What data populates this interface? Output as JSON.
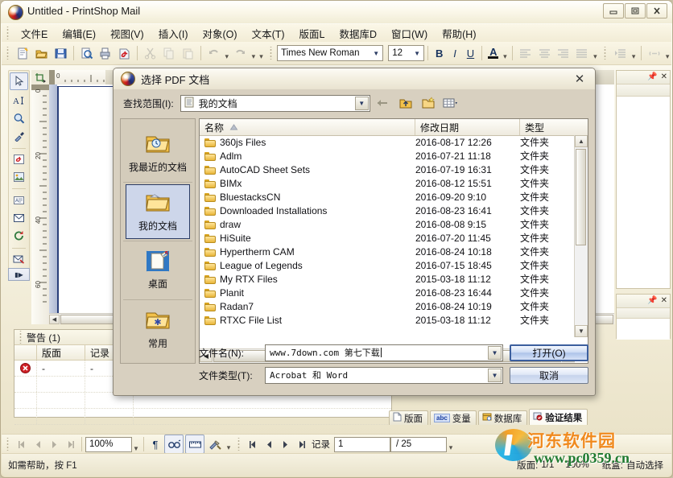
{
  "app": {
    "title": "Untitled - PrintShop Mail",
    "icon": "printshop-logo-icon",
    "window_buttons": [
      {
        "name": "minimize",
        "glyph": "minimize-icon"
      },
      {
        "name": "maximize",
        "glyph": "maximize-icon"
      },
      {
        "name": "close",
        "glyph": "close-icon"
      }
    ]
  },
  "menu": {
    "items": [
      {
        "label": "文件E"
      },
      {
        "label": "编辑(E)"
      },
      {
        "label": "视图(V)"
      },
      {
        "label": "插入(I)"
      },
      {
        "label": "对象(O)"
      },
      {
        "label": "文本(T)"
      },
      {
        "label": "版面L"
      },
      {
        "label": "数据库D"
      },
      {
        "label": "窗口(W)"
      },
      {
        "label": "帮助(H)"
      }
    ]
  },
  "toolbar": {
    "font_name": "Times New Roman",
    "font_size": "12",
    "bold": "B",
    "italic": "I",
    "underline": "U",
    "font_color": "A"
  },
  "document": {
    "ruler_h_origin": "0",
    "ruler_v_ticks": [
      "0",
      "20",
      "40",
      "60"
    ]
  },
  "warnings_panel": {
    "title": "警告 (1)",
    "columns": [
      "版面",
      "记录"
    ],
    "rows": [
      {
        "icon": "error-icon",
        "layout": "-",
        "record": "-"
      }
    ]
  },
  "bottom_tabs": [
    {
      "label": "版面",
      "icon": "page-icon",
      "active": false
    },
    {
      "label": "变量",
      "icon": "abc-icon",
      "active": false
    },
    {
      "label": "数据库",
      "icon": "database-icon",
      "active": false
    },
    {
      "label": "验证结果",
      "icon": "validate-icon",
      "active": true
    }
  ],
  "bottom_bar": {
    "zoom": "100%",
    "record_label": "记录",
    "record_current": "1",
    "record_total": "/ 25",
    "pilcrow": "¶"
  },
  "status_bar": {
    "help_text": "如需帮助，按 F1",
    "layout_label": "版面:",
    "layout_value": "1/1",
    "zoom_value": "100%",
    "tray_label": "纸盒:",
    "tray_value": "自动选择"
  },
  "watermark": {
    "site_cn": "河东软件园",
    "site_url": "www.pc0359.cn"
  },
  "dialog": {
    "title": "选择 PDF 文档",
    "icon": "printshop-logo-icon",
    "close_label": "✕",
    "look_in_label": "查找范围(I):",
    "look_in_value": "我的文档",
    "nav_buttons": [
      {
        "name": "back-button",
        "glyph": "arrow-left-icon"
      },
      {
        "name": "up-one-level-button",
        "glyph": "folder-up-icon"
      },
      {
        "name": "new-folder-button",
        "glyph": "new-folder-icon"
      },
      {
        "name": "views-button",
        "glyph": "view-list-icon"
      }
    ],
    "places": [
      {
        "label": "我最近的文档",
        "icon": "recent-documents-icon",
        "selected": false
      },
      {
        "label": "我的文档",
        "icon": "my-documents-icon",
        "selected": true
      },
      {
        "label": "桌面",
        "icon": "desktop-icon",
        "selected": false
      },
      {
        "label": "常用",
        "icon": "favorites-icon",
        "selected": false
      }
    ],
    "list": {
      "columns": [
        "名称",
        "修改日期",
        "类型"
      ],
      "sort_column": 0,
      "sort_glyph": "sort-ascending-icon",
      "rows": [
        {
          "name": "360js Files",
          "date": "2016-08-17 12:26",
          "type": "文件夹"
        },
        {
          "name": "Adlm",
          "date": "2016-07-21 11:18",
          "type": "文件夹"
        },
        {
          "name": "AutoCAD Sheet Sets",
          "date": "2016-07-19 16:31",
          "type": "文件夹"
        },
        {
          "name": "BIMx",
          "date": "2016-08-12 15:51",
          "type": "文件夹"
        },
        {
          "name": "BluestacksCN",
          "date": "2016-09-20 9:10",
          "type": "文件夹"
        },
        {
          "name": "Downloaded Installations",
          "date": "2016-08-23 16:41",
          "type": "文件夹"
        },
        {
          "name": "draw",
          "date": "2016-08-08 9:15",
          "type": "文件夹"
        },
        {
          "name": "HiSuite",
          "date": "2016-07-20 11:45",
          "type": "文件夹"
        },
        {
          "name": "Hypertherm CAM",
          "date": "2016-08-24 10:18",
          "type": "文件夹"
        },
        {
          "name": "League of Legends",
          "date": "2016-07-15 18:45",
          "type": "文件夹"
        },
        {
          "name": "My RTX Files",
          "date": "2015-03-18 11:12",
          "type": "文件夹"
        },
        {
          "name": "Planit",
          "date": "2016-08-23 16:44",
          "type": "文件夹"
        },
        {
          "name": "Radan7",
          "date": "2016-08-24 10:19",
          "type": "文件夹"
        },
        {
          "name": "RTXC File List",
          "date": "2015-03-18 11:12",
          "type": "文件夹"
        }
      ]
    },
    "file_name_label": "文件名(N):",
    "file_name_value": "www.7down.com 第七下载",
    "file_type_label": "文件类型(T):",
    "file_type_value": "Acrobat 和 Word",
    "open_button": "打开(O)",
    "cancel_button": "取消"
  }
}
